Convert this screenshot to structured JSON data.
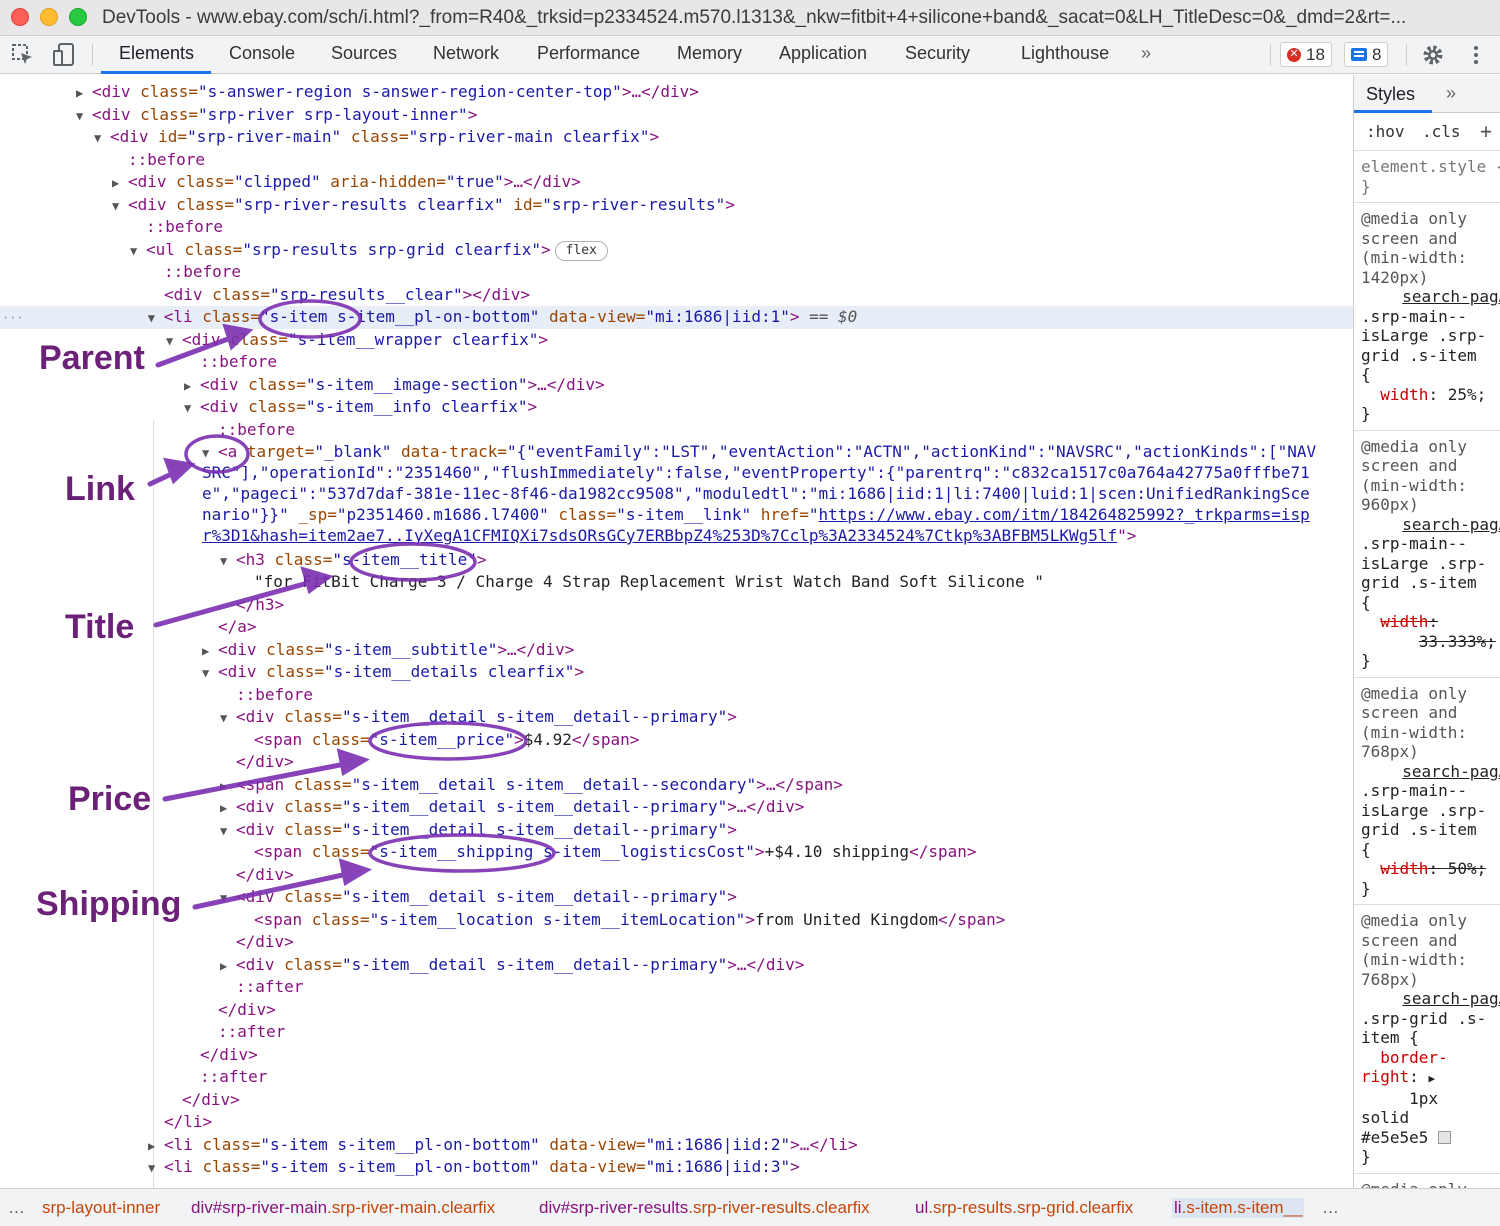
{
  "window": {
    "title": "DevTools - www.ebay.com/sch/i.html?_from=R40&_trksid=p2334524.m570.l1313&_nkw=fitbit+4+silicone+band&_sacat=0&LH_TitleDesc=0&_dmd=2&rt=..."
  },
  "toolbar": {
    "tabs": [
      "Elements",
      "Console",
      "Sources",
      "Network",
      "Performance",
      "Memory",
      "Application",
      "Security",
      "Lighthouse"
    ],
    "more": "»",
    "errors_count": "18",
    "messages_count": "8"
  },
  "dom": {
    "l1": {
      "tag": "<div",
      "a1": " class=",
      "v1": "\"s-answer-region s-answer-region-center-top\"",
      "end": ">…</div>"
    },
    "l2": {
      "tag": "<div",
      "a1": " class=",
      "v1": "\"srp-river srp-layout-inner\"",
      "end": ">"
    },
    "l3": {
      "tag": "<div",
      "a1": " id=",
      "v1": "\"srp-river-main\"",
      "a2": " class=",
      "v2": "\"srp-river-main clearfix\"",
      "end": ">"
    },
    "l4": {
      "ps": "::before"
    },
    "l5": {
      "tag": "<div",
      "a1": " class=",
      "v1": "\"clipped\"",
      "a2": " aria-hidden=",
      "v2": "\"true\"",
      "end": ">…</div>"
    },
    "l6": {
      "tag": "<div",
      "a1": " class=",
      "v1": "\"srp-river-results clearfix\"",
      "a2": " id=",
      "v2": "\"srp-river-results\"",
      "end": ">"
    },
    "l7": {
      "ps": "::before"
    },
    "l8": {
      "tag": "<ul",
      "a1": " class=",
      "v1": "\"srp-results srp-grid clearfix\"",
      "end": ">",
      "pill": "flex"
    },
    "l9": {
      "ps": "::before"
    },
    "l10": {
      "tag": "<div",
      "a1": " class=",
      "v1": "\"srp-results__clear\"",
      "end": "></div>"
    },
    "l11": {
      "tag": "<li",
      "a1": " class=",
      "v1": "\"s-item s-item__pl-on-bottom\"",
      "a2": " data-view=",
      "v2": "\"mi:1686|iid:1\"",
      "end": ">",
      "eq": " == $0"
    },
    "l12": {
      "tag": "<div",
      "a1": " class=",
      "v1": "\"s-item__wrapper clearfix\"",
      "end": ">"
    },
    "l13": {
      "ps": "::before"
    },
    "l14": {
      "tag": "<div",
      "a1": " class=",
      "v1": "\"s-item__image-section\"",
      "end": ">…</div>"
    },
    "l15": {
      "tag": "<div",
      "a1": " class=",
      "v1": "\"s-item__info clearfix\"",
      "end": ">"
    },
    "l16": {
      "ps": "::before"
    },
    "l17": {
      "tag": "<a",
      "a1": " target=",
      "v1": "\"_blank\"",
      "a2": " data-track=",
      "v2": "\"{\"eventFamily\":\"LST\",\"eventAction\":\"ACTN\",\"actionKind\":\"NAVSRC\",\"actionKinds\":[\"NAV"
    },
    "l18": {
      "v": "SRC\"],\"operationId\":\"2351460\",\"flushImmediately\":false,\"eventProperty\":{\"parentrq\":\"c832ca1517c0a764a42775a0fffbe71"
    },
    "l19": {
      "v": "e\",\"pageci\":\"537d7daf-381e-11ec-8f46-da1982cc9508\",\"moduledtl\":\"mi:1686|iid:1|li:7400|luid:1|scen:UnifiedRankingSce"
    },
    "l20": {
      "v": "nario\"}}\"",
      "a2": " _sp=",
      "v2": "\"p2351460.m1686.l7400\"",
      "a3": " class=",
      "v3": "\"s-item__link\"",
      "a4": " href=",
      "v4": "\"",
      "link": "https://www.ebay.com/itm/184264825992?_trkparms=isp"
    },
    "l21": {
      "link": "r%3D1&hash=item2ae7..IyXegA1CFMIQXi7sdsORsGCy7ERBbpZ4%253D%7Cclp%3A2334524%7Ctkp%3ABFBM5LKWg5lf",
      "end": "\">"
    },
    "l22": {
      "tag": "<h3",
      "a1": " class=",
      "v1": "\"s-item__title\"",
      "end": ">"
    },
    "l23": {
      "tx": "\"for FitBit Charge 3 / Charge 4 Strap Replacement Wrist Watch Band Soft Silicone \""
    },
    "l24": {
      "tag": "</h3>"
    },
    "l25": {
      "tag": "</a>"
    },
    "l26": {
      "tag": "<div",
      "a1": " class=",
      "v1": "\"s-item__subtitle\"",
      "end": ">…</div>"
    },
    "l27": {
      "tag": "<div",
      "a1": " class=",
      "v1": "\"s-item__details clearfix\"",
      "end": ">"
    },
    "l28": {
      "ps": "::before"
    },
    "l29": {
      "tag": "<div",
      "a1": " class=",
      "v1": "\"s-item__detail s-item__detail--primary\"",
      "end": ">"
    },
    "l30": {
      "tag": "<span",
      "a1": " class=",
      "v1": "\"s-item__price\"",
      "end": ">",
      "tx": "$4.92",
      "close": "</span>"
    },
    "l31": {
      "tag": "</div>"
    },
    "l32": {
      "tag": "<span",
      "a1": " class=",
      "v1": "\"s-item__detail s-item__detail--secondary\"",
      "end": ">…</span>"
    },
    "l33": {
      "tag": "<div",
      "a1": " class=",
      "v1": "\"s-item__detail s-item__detail--primary\"",
      "end": ">…</div>"
    },
    "l34": {
      "tag": "<div",
      "a1": " class=",
      "v1": "\"s-item__detail s-item__detail--primary\"",
      "end": ">"
    },
    "l35": {
      "tag": "<span",
      "a1": " class=",
      "v1": "\"s-item__shipping s-item__logisticsCost\"",
      "end": ">",
      "tx": "+$4.10 shipping",
      "close": "</span>"
    },
    "l36": {
      "tag": "</div>"
    },
    "l37": {
      "tag": "<div",
      "a1": " class=",
      "v1": "\"s-item__detail s-item__detail--primary\"",
      "end": ">"
    },
    "l38": {
      "tag": "<span",
      "a1": " class=",
      "v1": "\"s-item__location s-item__itemLocation\"",
      "end": ">",
      "tx": "from United Kingdom",
      "close": "</span>"
    },
    "l39": {
      "tag": "</div>"
    },
    "l40": {
      "tag": "<div",
      "a1": " class=",
      "v1": "\"s-item__detail s-item__detail--primary\"",
      "end": ">…</div>"
    },
    "l41": {
      "ps": "::after"
    },
    "l42": {
      "tag": "</div>"
    },
    "l43": {
      "ps": "::after"
    },
    "l44": {
      "tag": "</div>"
    },
    "l45": {
      "ps": "::after"
    },
    "l46": {
      "tag": "</div>"
    },
    "l47": {
      "tag": "</li>"
    },
    "l48": {
      "tag": "<li",
      "a1": " class=",
      "v1": "\"s-item s-item__pl-on-bottom\"",
      "a2": " data-view=",
      "v2": "\"mi:1686|iid:2\"",
      "end": ">…</li>"
    },
    "l49": {
      "tag": "<li",
      "a1": " class=",
      "v1": "\"s-item s-item__pl-on-bottom\"",
      "a2": " data-view=",
      "v2": "\"mi:1686|iid:3\"",
      "end": ">"
    }
  },
  "annotations": {
    "parent": "Parent",
    "link": "Link",
    "title": "Title",
    "price": "Price",
    "shipping": "Shipping",
    "color": "#6b2177"
  },
  "styles_pane": {
    "tab": "Styles",
    "more": "»",
    "hov": ":hov",
    "cls": ".cls",
    "add": "+",
    "element_style": "element.style {\n}",
    "rules": [
      {
        "media": "@media only\nscreen and\n(min-width:\n1420px)",
        "source": "search-pag…",
        "selector": ".srp-main--\nisLarge .srp-\ngrid .s-item\n{",
        "prop": "width",
        "value": "25%;",
        "struck": false
      },
      {
        "media": "@media only\nscreen and\n(min-width:\n960px)",
        "source": "search-pag…",
        "selector": ".srp-main--\nisLarge .srp-\ngrid .s-item\n{",
        "prop": "width",
        "value": "33.333%;",
        "struck": true
      },
      {
        "media": "@media only\nscreen and\n(min-width:\n768px)",
        "source": "search-pag…",
        "selector": ".srp-main--\nisLarge .srp-\ngrid .s-item\n{",
        "prop": "width",
        "value": "50%;",
        "struck": true
      },
      {
        "media": "@media only\nscreen and\n(min-width:\n768px)",
        "source": "search-pag…",
        "selector": ".srp-grid .s-\nitem {",
        "prop": "border-\nright",
        "value": "1px\nsolid\n#e5e5e5",
        "struck": false
      }
    ],
    "last_partial": "@media only"
  },
  "breadcrumbs": [
    {
      "tag": "",
      "cls": "srp-layout-inner"
    },
    {
      "tag": "div#srp-river-main",
      "cls": ".srp-river-main.clearfix"
    },
    {
      "tag": "div#srp-river-results",
      "cls": ".srp-river-results.clearfix"
    },
    {
      "tag": "ul",
      "cls": ".srp-results.srp-grid.clearfix"
    },
    {
      "tag": "li",
      "cls": ".s-item.s-item__"
    }
  ],
  "breadcrumb_ellipsis": "…"
}
